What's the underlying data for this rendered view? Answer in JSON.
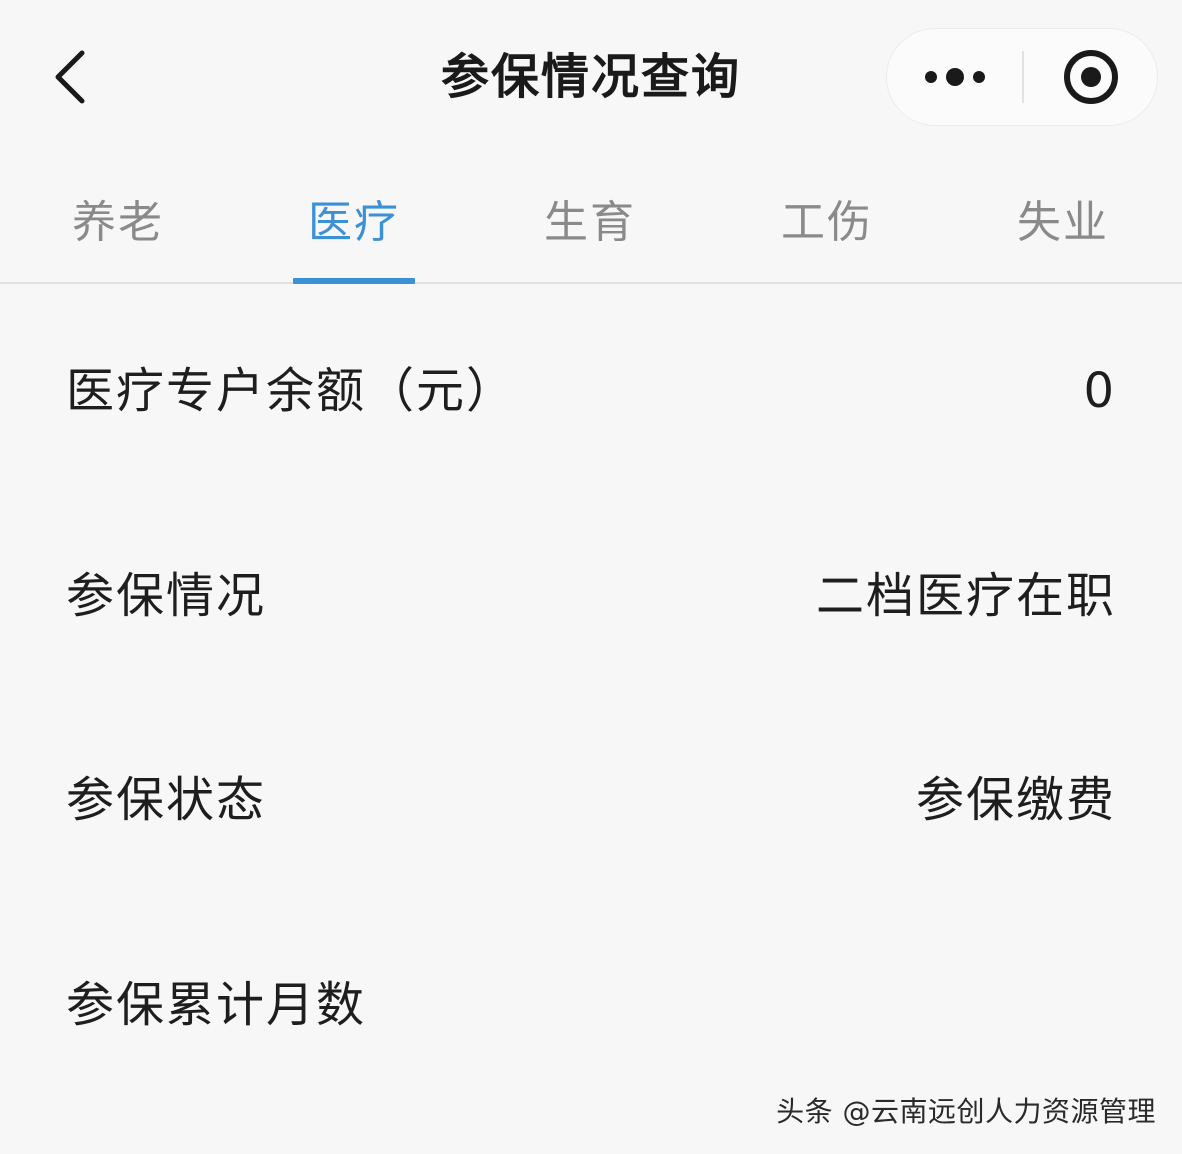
{
  "header": {
    "title": "参保情况查询",
    "back_icon": "chevron-left-icon",
    "more_icon": "more-dots-icon",
    "close_icon": "target-circle-icon"
  },
  "tabs": [
    {
      "label": "养老",
      "active": false
    },
    {
      "label": "医疗",
      "active": true
    },
    {
      "label": "生育",
      "active": false
    },
    {
      "label": "工伤",
      "active": false
    },
    {
      "label": "失业",
      "active": false
    }
  ],
  "rows": [
    {
      "label": "医疗专户余额（元）",
      "value": "0"
    },
    {
      "label": "参保情况",
      "value": "二档医疗在职"
    },
    {
      "label": "参保状态",
      "value": "参保缴费"
    },
    {
      "label": "参保累计月数",
      "value": ""
    }
  ],
  "watermark": "头条 @云南远创人力资源管理",
  "colors": {
    "accent": "#3c90d5",
    "background": "#f7f7f8",
    "text": "#1e1e1e",
    "tab_inactive": "#8a8a8a"
  }
}
